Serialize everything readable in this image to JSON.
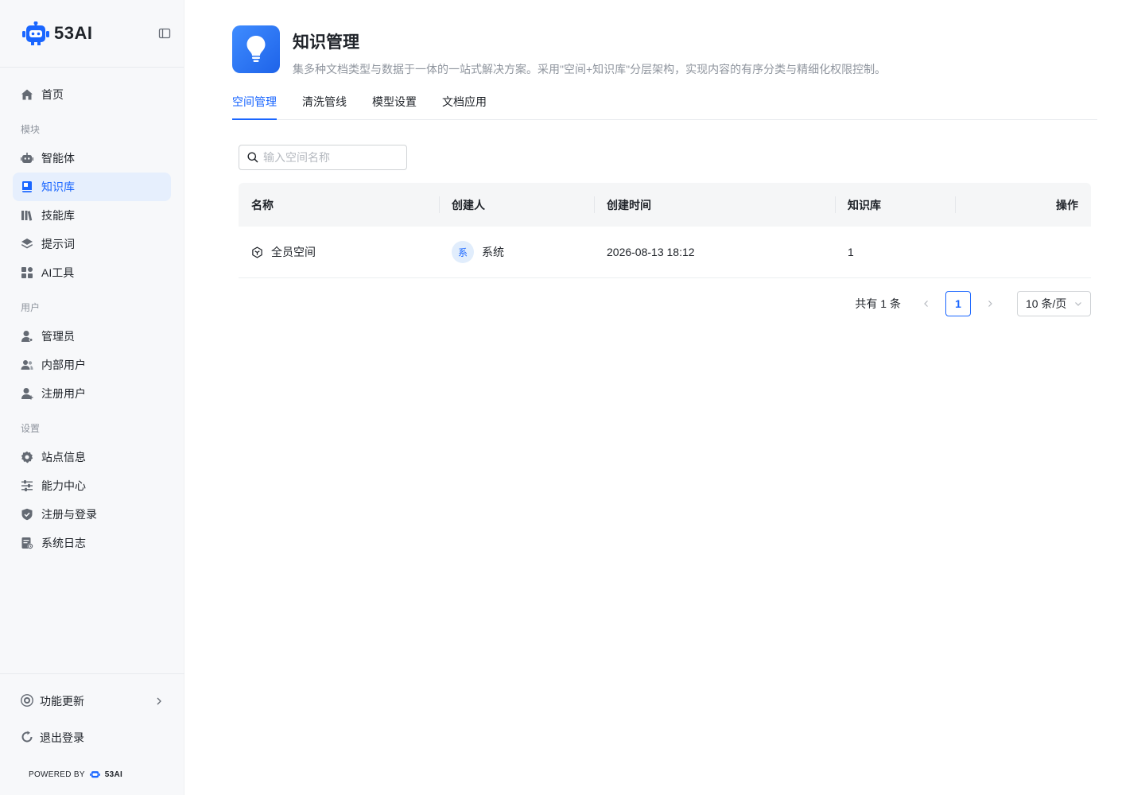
{
  "brand": {
    "name": "53AI",
    "powered_by": "POWERED BY",
    "powered_brand": "53AI"
  },
  "sidebar": {
    "home": "首页",
    "groups": {
      "modules": "模块",
      "users": "用户",
      "settings": "设置"
    },
    "modules": [
      {
        "label": "智能体",
        "icon": "robot-icon"
      },
      {
        "label": "知识库",
        "icon": "book-icon",
        "active": true
      },
      {
        "label": "技能库",
        "icon": "library-icon"
      },
      {
        "label": "提示词",
        "icon": "layers-icon"
      },
      {
        "label": "AI工具",
        "icon": "apps-icon"
      }
    ],
    "users": [
      {
        "label": "管理员",
        "icon": "admin-user-icon"
      },
      {
        "label": "内部用户",
        "icon": "team-icon"
      },
      {
        "label": "注册用户",
        "icon": "add-user-icon"
      }
    ],
    "settings": [
      {
        "label": "站点信息",
        "icon": "gear-icon"
      },
      {
        "label": "能力中心",
        "icon": "sliders-icon"
      },
      {
        "label": "注册与登录",
        "icon": "shield-icon"
      },
      {
        "label": "系统日志",
        "icon": "log-icon"
      }
    ],
    "updates": "功能更新",
    "logout": "退出登录"
  },
  "page": {
    "title": "知识管理",
    "description": "集多种文档类型与数据于一体的一站式解决方案。采用\"空间+知识库\"分层架构，实现内容的有序分类与精细化权限控制。",
    "tabs": [
      "空间管理",
      "清洗管线",
      "模型设置",
      "文档应用"
    ],
    "active_tab": 0
  },
  "search": {
    "placeholder": "输入空间名称",
    "value": ""
  },
  "table": {
    "columns": [
      "名称",
      "创建人",
      "创建时间",
      "知识库",
      "操作"
    ],
    "rows": [
      {
        "name": "全员空间",
        "creator_avatar": "系",
        "creator": "系统",
        "created_at": "2026-08-13 18:12",
        "kb_count": "1",
        "actions": ""
      }
    ]
  },
  "pagination": {
    "total_text": "共有 1 条",
    "current_page": "1",
    "page_size": "10 条/页"
  },
  "colors": {
    "accent": "#1a66ff",
    "sidebar_bg": "#f7f8fa",
    "active_bg": "#e6effd"
  }
}
